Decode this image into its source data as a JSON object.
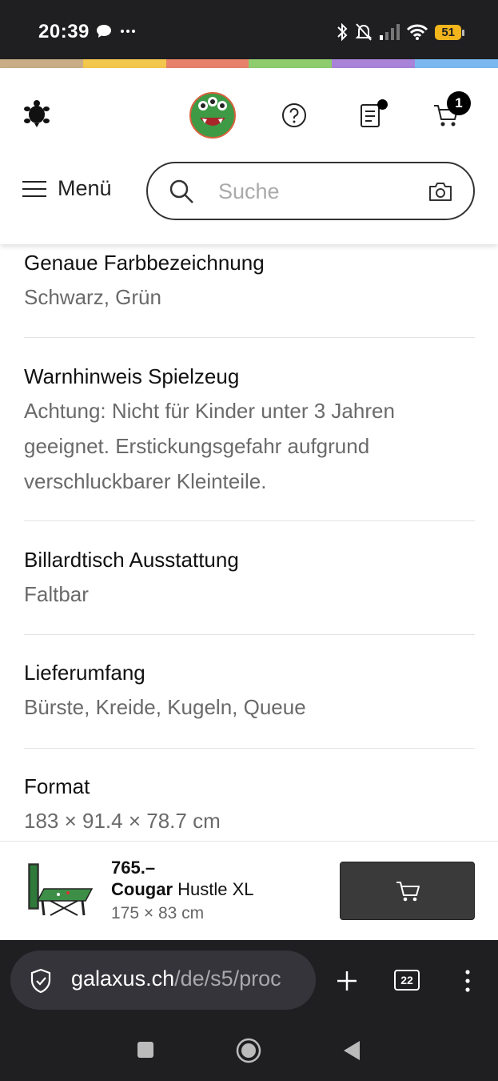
{
  "status_bar": {
    "time": "20:39",
    "battery": "51",
    "icons": [
      "chat-bubble-icon",
      "more-dots-icon",
      "bluetooth-icon",
      "bell-muted-icon",
      "signal-icon",
      "wifi-icon"
    ]
  },
  "brand_colors": [
    "#c9ad86",
    "#f3c64c",
    "#e8816a",
    "#8fcc6e",
    "#a883d8",
    "#7bb8ef"
  ],
  "header": {
    "menu_label": "Menü",
    "search_placeholder": "Suche",
    "cart_count": "1"
  },
  "specs": [
    {
      "title": "Genaue Farbbezeichnung",
      "value": "Schwarz, Grün"
    },
    {
      "title": "Warnhinweis Spielzeug",
      "value": "Achtung: Nicht für Kinder unter 3 Jahren geeignet. Erstickungsgefahr aufgrund verschluckbarer Kleinteile."
    },
    {
      "title": "Billardtisch Ausstattung",
      "value": "Faltbar"
    },
    {
      "title": "Lieferumfang",
      "value": "Bürste, Kreide, Kugeln, Queue"
    },
    {
      "title": "Format",
      "value": "183 × 91.4 × 78.7 cm"
    }
  ],
  "product": {
    "price": "765.–",
    "brand": "Cougar",
    "name": "Hustle XL",
    "size": "175 × 83 cm"
  },
  "browser": {
    "url_host": "galaxus.ch",
    "url_path": "/de/s5/proc",
    "tab_count": "22"
  }
}
